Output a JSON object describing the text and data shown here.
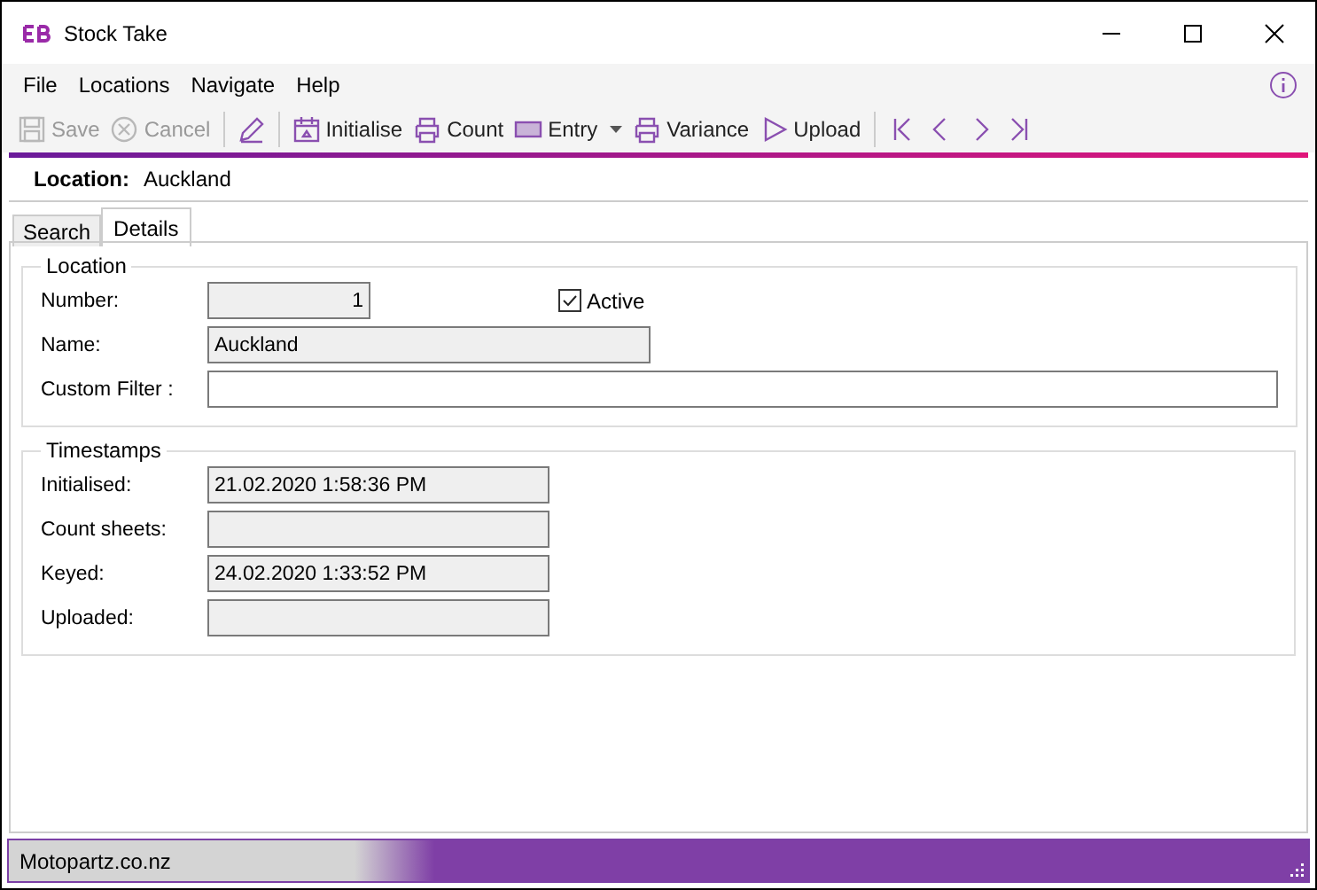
{
  "window": {
    "title": "Stock Take"
  },
  "menu": [
    {
      "label": "File"
    },
    {
      "label": "Locations"
    },
    {
      "label": "Navigate"
    },
    {
      "label": "Help"
    }
  ],
  "toolbar": [
    {
      "kind": "button",
      "label": "Save",
      "disabled": true
    },
    {
      "kind": "button",
      "label": "Cancel",
      "disabled": true
    },
    {
      "kind": "separator"
    },
    {
      "kind": "icon",
      "disabled": false
    },
    {
      "kind": "separator"
    },
    {
      "kind": "button",
      "label": "Initialise",
      "disabled": false
    },
    {
      "kind": "button",
      "label": "Count",
      "disabled": false
    },
    {
      "kind": "dropdown",
      "label": "Entry",
      "disabled": false
    },
    {
      "kind": "button",
      "label": "Variance",
      "disabled": false
    },
    {
      "kind": "button",
      "label": "Upload",
      "disabled": false
    },
    {
      "kind": "separator"
    },
    {
      "kind": "icon",
      "disabled": false
    },
    {
      "kind": "icon",
      "disabled": false
    },
    {
      "kind": "icon",
      "disabled": false
    },
    {
      "kind": "icon",
      "disabled": false
    }
  ],
  "header": {
    "label": "Location:",
    "value": "Auckland"
  },
  "tabs": [
    {
      "label": "Search",
      "selected": false
    },
    {
      "label": "Details",
      "selected": true
    }
  ],
  "location_group": {
    "title": "Location",
    "number": {
      "label": "Number:",
      "value": "1",
      "readonly": true
    },
    "active": {
      "label": "Active",
      "checked": true
    },
    "name": {
      "label": "Name:",
      "value": "Auckland",
      "readonly": true
    },
    "custom_filter": {
      "label": "Custom Filter :",
      "readonly": false
    }
  },
  "timestamps_group": {
    "title": "Timestamps",
    "fields": [
      {
        "label": "Initialised:",
        "value": "21.02.2020 1:58:36 PM",
        "readonly": true
      },
      {
        "label": "Count sheets:",
        "readonly": true
      },
      {
        "label": "Keyed:",
        "value": "24.02.2020 1:33:52 PM",
        "readonly": true
      },
      {
        "label": "Uploaded:",
        "readonly": true
      }
    ]
  },
  "status_bar": {
    "text": "Motopartz.co.nz"
  }
}
